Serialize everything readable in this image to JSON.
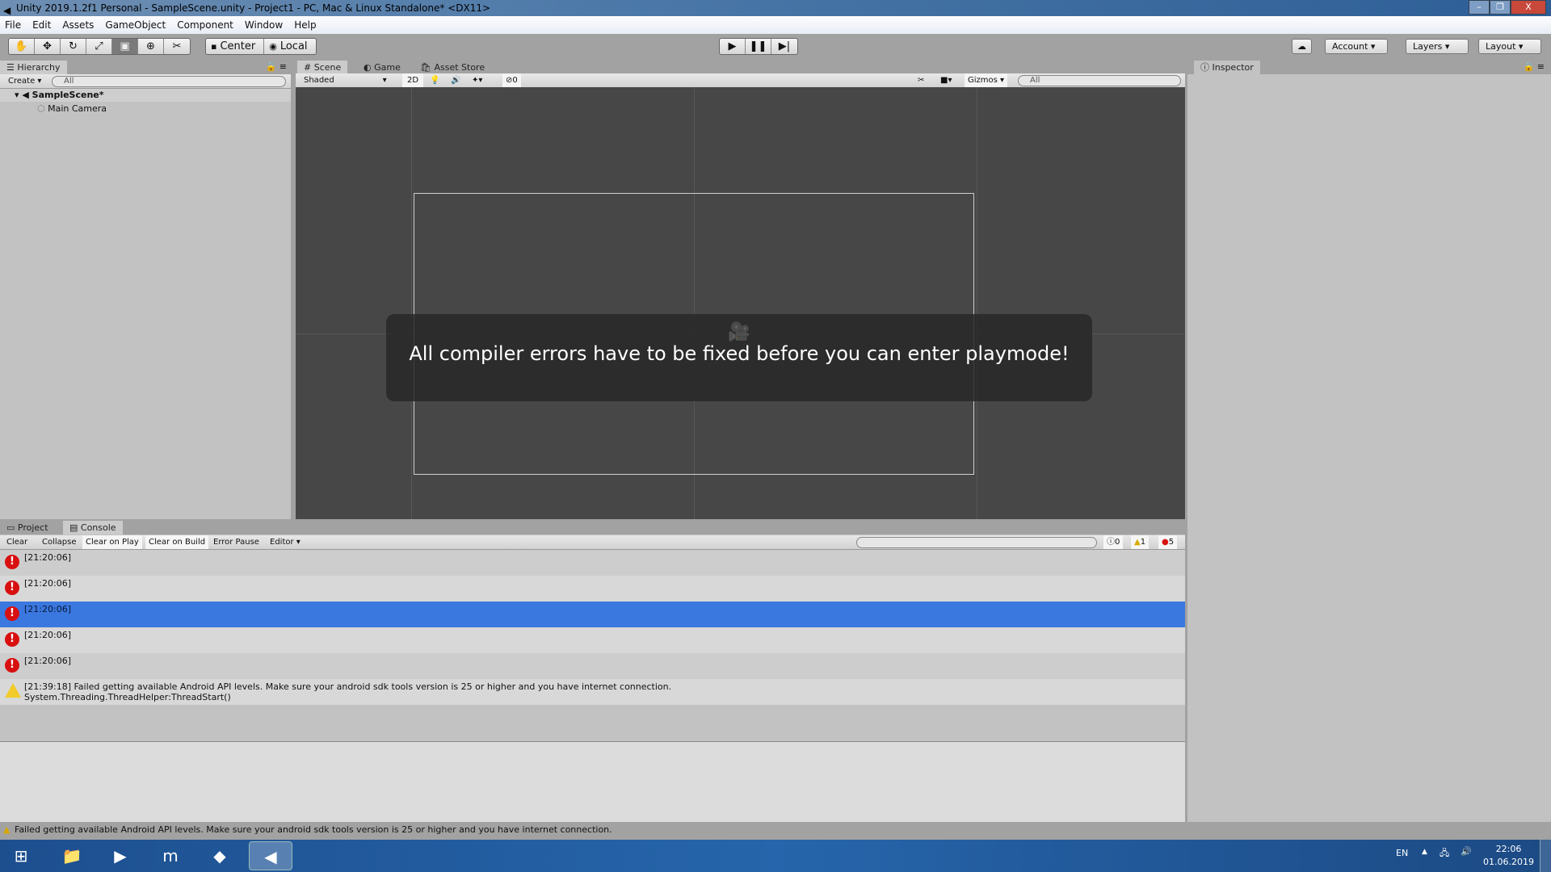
{
  "window": {
    "title": "Unity 2019.1.2f1 Personal - SampleScene.unity - Project1 - PC, Mac & Linux Standalone* <DX11>",
    "minimize": "–",
    "maximize": "❐",
    "close": "X"
  },
  "menu": [
    "File",
    "Edit",
    "Assets",
    "GameObject",
    "Component",
    "Window",
    "Help"
  ],
  "toolbar": {
    "tools": [
      "hand-tool",
      "move-tool",
      "rotate-tool",
      "scale-tool",
      "rect-tool",
      "transform-tool",
      "custom-tool"
    ],
    "active_tool": "rect-tool",
    "pivot": "Center",
    "space": "Local",
    "account": "Account",
    "layers": "Layers",
    "layout": "Layout"
  },
  "hierarchy": {
    "tab": "Hierarchy",
    "create": "Create",
    "search_placeholder": "All",
    "scene": "SampleScene*",
    "items": [
      "Main Camera"
    ]
  },
  "scene_view": {
    "tabs": [
      "Scene",
      "Game",
      "Asset Store"
    ],
    "active_tab": "Scene",
    "shading": "Shaded",
    "mode_2d": "2D",
    "hidden_count": "0",
    "gizmos": "Gizmos",
    "search_placeholder": "All",
    "notification": "All compiler errors have to be fixed before you can enter playmode!"
  },
  "inspector": {
    "tab": "Inspector"
  },
  "console": {
    "tabs": [
      "Project",
      "Console"
    ],
    "active_tab": "Console",
    "buttons": [
      "Clear",
      "Collapse",
      "Clear on Play",
      "Clear on Build",
      "Error Pause",
      "Editor"
    ],
    "counts": {
      "info": "0",
      "warnings": "1",
      "errors": "5"
    },
    "entries": [
      {
        "type": "error",
        "text": "[21:20:06]",
        "selected": false
      },
      {
        "type": "error",
        "text": "[21:20:06]",
        "selected": false
      },
      {
        "type": "error",
        "text": "[21:20:06]",
        "selected": true
      },
      {
        "type": "error",
        "text": "[21:20:06]",
        "selected": false
      },
      {
        "type": "error",
        "text": "[21:20:06]",
        "selected": false
      },
      {
        "type": "warning",
        "text": "[21:39:18] Failed getting available Android API levels. Make sure your android sdk tools version is 25 or higher and you have internet connection.",
        "text2": "System.Threading.ThreadHelper:ThreadStart()",
        "selected": false
      }
    ]
  },
  "status_bar": "Failed getting available Android API levels. Make sure your android sdk tools version is 25 or higher and you have internet connection.",
  "taskbar": {
    "language": "EN",
    "time": "22:06",
    "date": "01.06.2019"
  },
  "colors": {
    "selection": "#3a78e0",
    "error": "#d81010",
    "warning": "#f1cc2a",
    "scene_bg": "#474747"
  }
}
